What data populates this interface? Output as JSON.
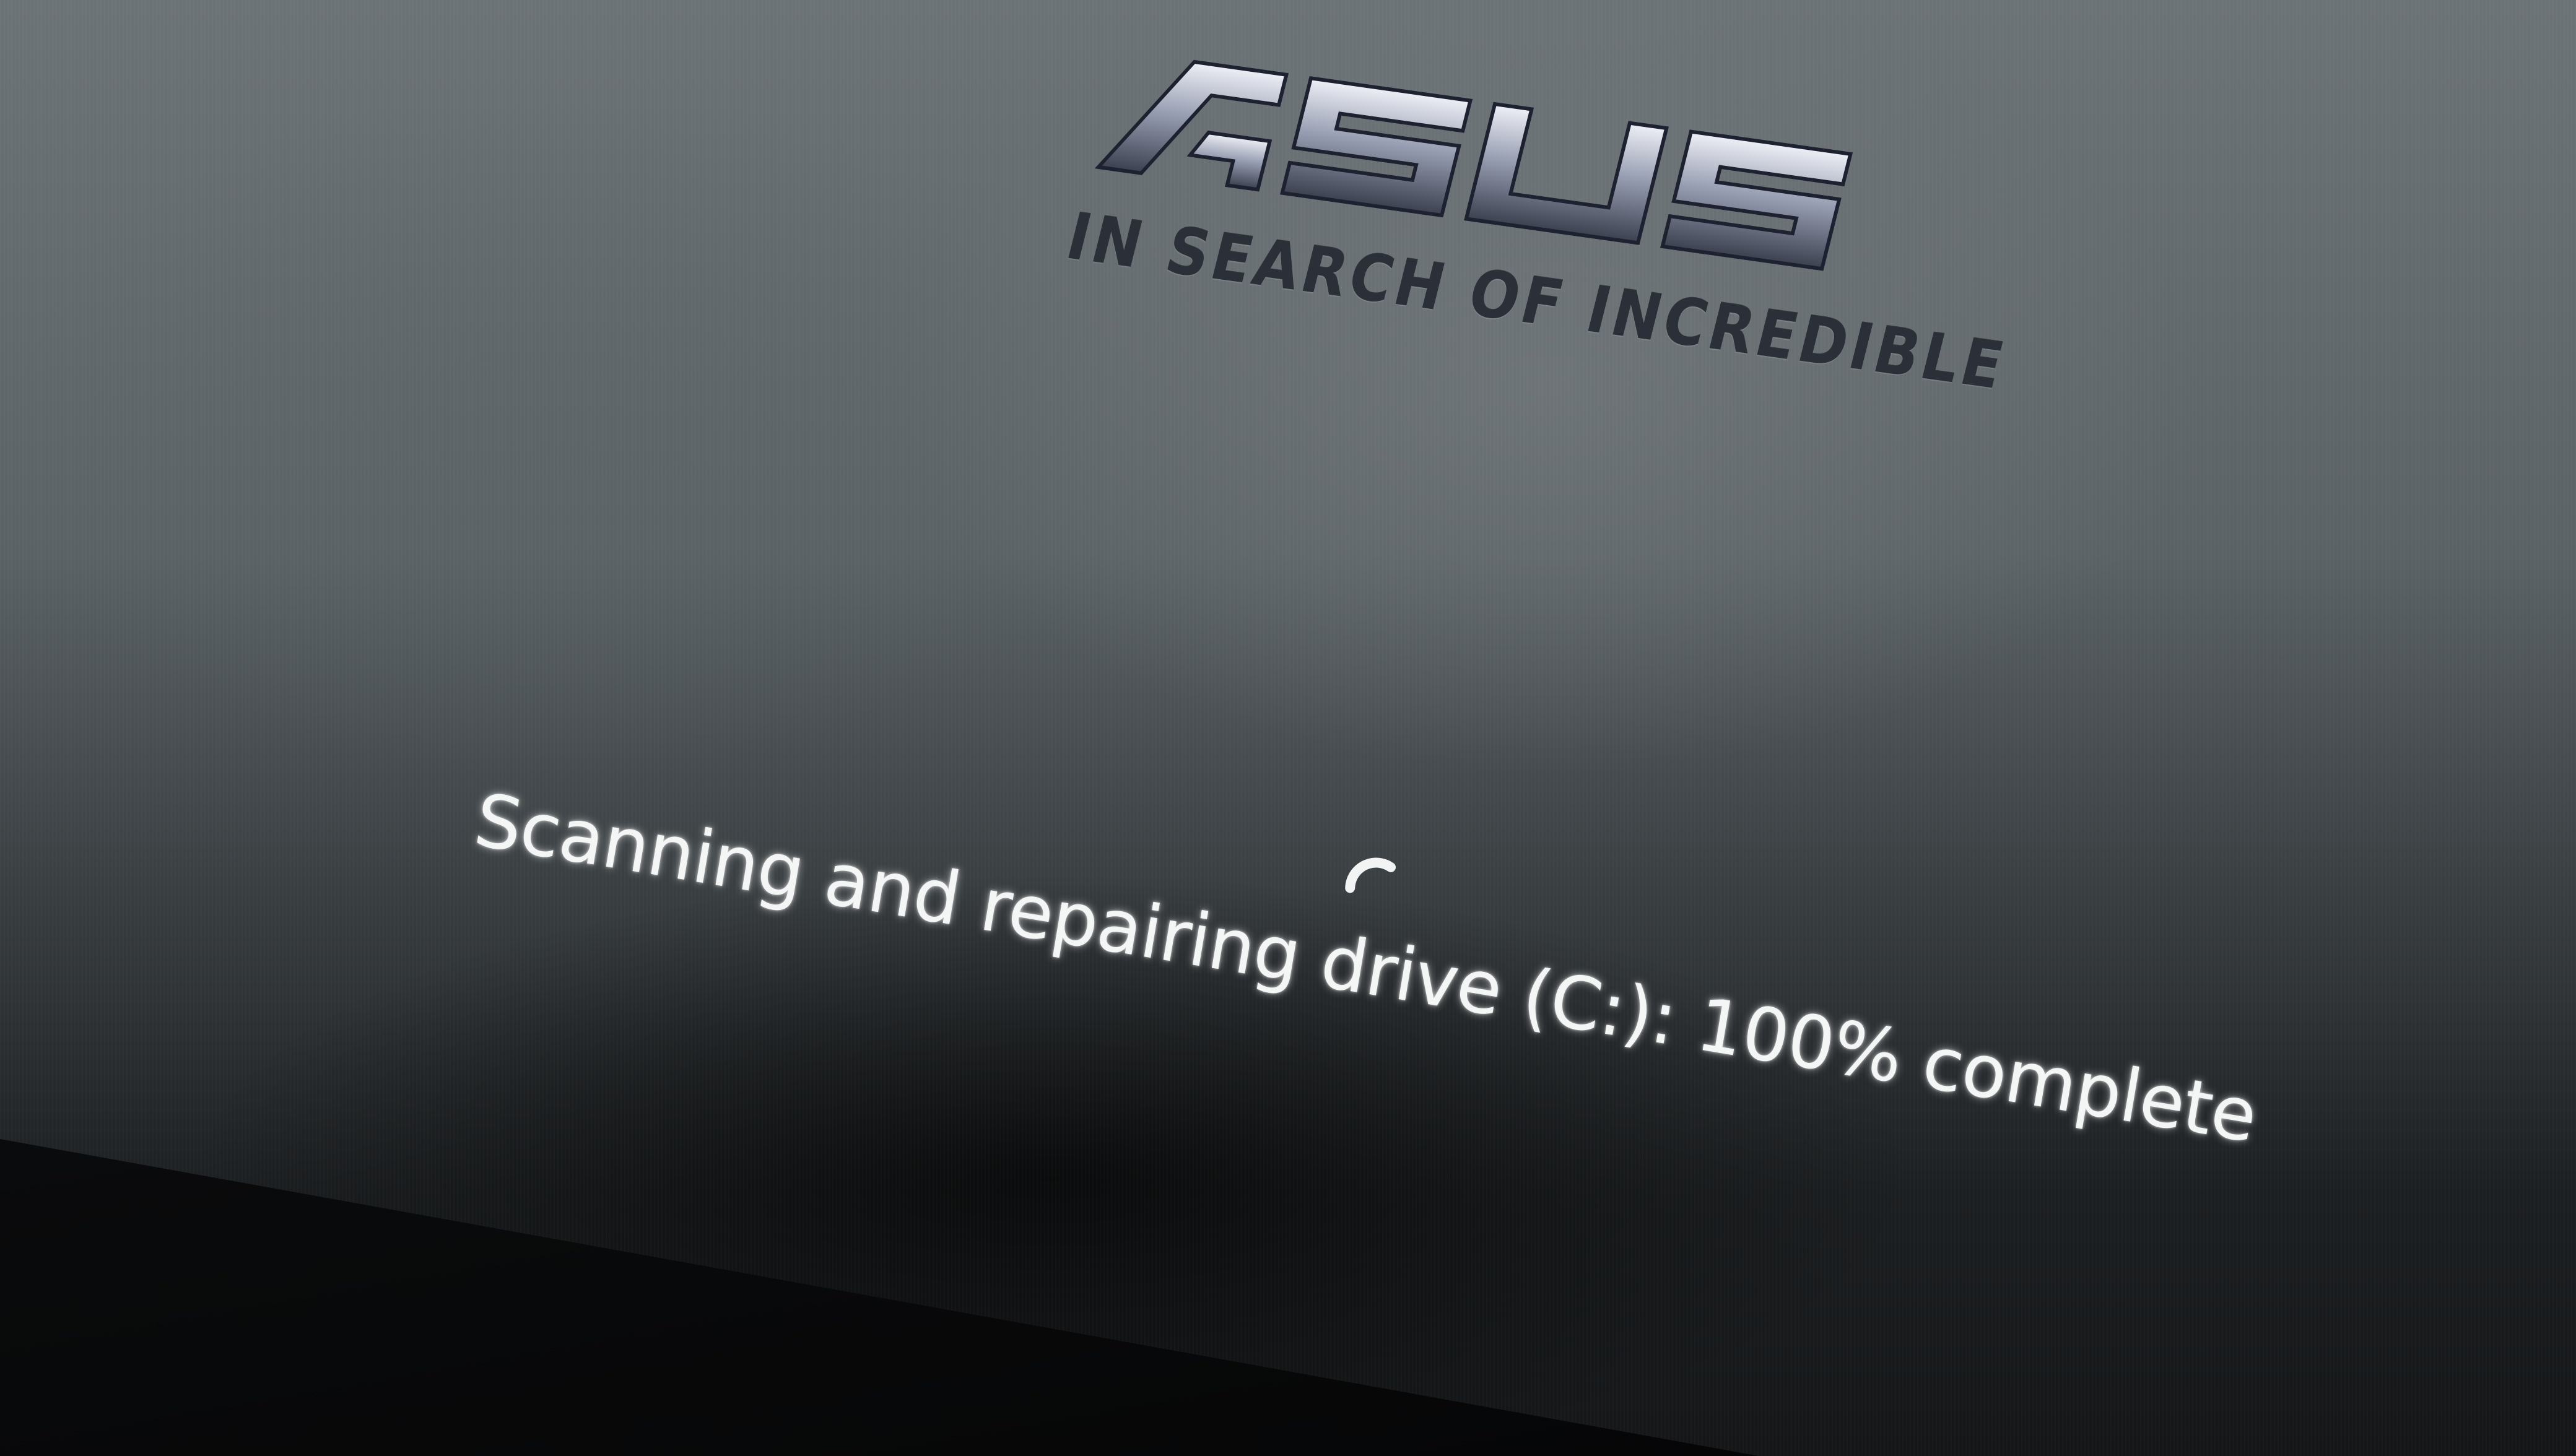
{
  "boot_screen": {
    "brand": "ASUS",
    "tagline": "IN SEARCH OF INCREDIBLE",
    "status_message": "Scanning and repairing drive (C:): 100% complete",
    "progress": {
      "drive": "C:",
      "percent_complete": 100
    },
    "spinner_icon": "loading-spinner-icon"
  },
  "colors": {
    "status_text": "#f4f6f6",
    "logo_metal": "#c8ccd8",
    "screen_background": "#5b6266",
    "bezel": "#0a0b0c"
  }
}
